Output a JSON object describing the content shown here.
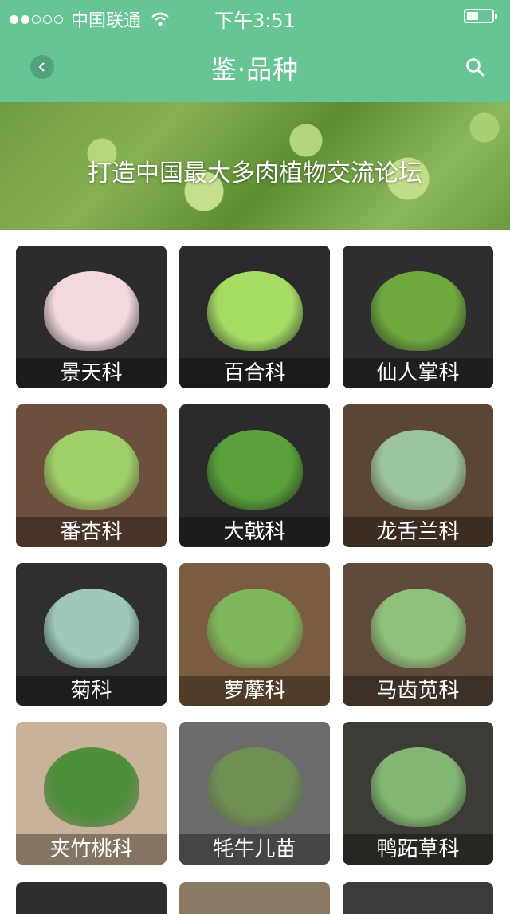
{
  "status": {
    "carrier": "中国联通",
    "time": "下午3:51"
  },
  "nav": {
    "title": "鉴·品种"
  },
  "banner": {
    "text": "打造中国最大多肉植物交流论坛"
  },
  "categories": [
    {
      "label": "景天科",
      "bg": "#2c2c2c",
      "plant": "#f2d9de"
    },
    {
      "label": "百合科",
      "bg": "#2a2a2a",
      "plant": "#a6dc64"
    },
    {
      "label": "仙人掌科",
      "bg": "#2e2e2e",
      "plant": "#6fa83e"
    },
    {
      "label": "番杏科",
      "bg": "#6d4f3d",
      "plant": "#9fcf6a"
    },
    {
      "label": "大戟科",
      "bg": "#2b2b2b",
      "plant": "#58a13b"
    },
    {
      "label": "龙舌兰科",
      "bg": "#5b4535",
      "plant": "#9cc3a0"
    },
    {
      "label": "菊科",
      "bg": "#2f2f2f",
      "plant": "#9fc8b8"
    },
    {
      "label": "萝藦科",
      "bg": "#7a5c40",
      "plant": "#7fb85c"
    },
    {
      "label": "马齿苋科",
      "bg": "#5f4a3c",
      "plant": "#8fc07c"
    },
    {
      "label": "夹竹桃科",
      "bg": "#c9b29a",
      "plant": "#4d8f3a"
    },
    {
      "label": "牦牛儿苗",
      "bg": "#6b6b6b",
      "plant": "#6f8f55"
    },
    {
      "label": "鸭跖草科",
      "bg": "#3d3b35",
      "plant": "#82b873"
    }
  ],
  "partial_row": [
    {
      "bg": "#2e2e2e"
    },
    {
      "bg": "#8b7a63"
    },
    {
      "bg": "#3b3b3b"
    }
  ]
}
